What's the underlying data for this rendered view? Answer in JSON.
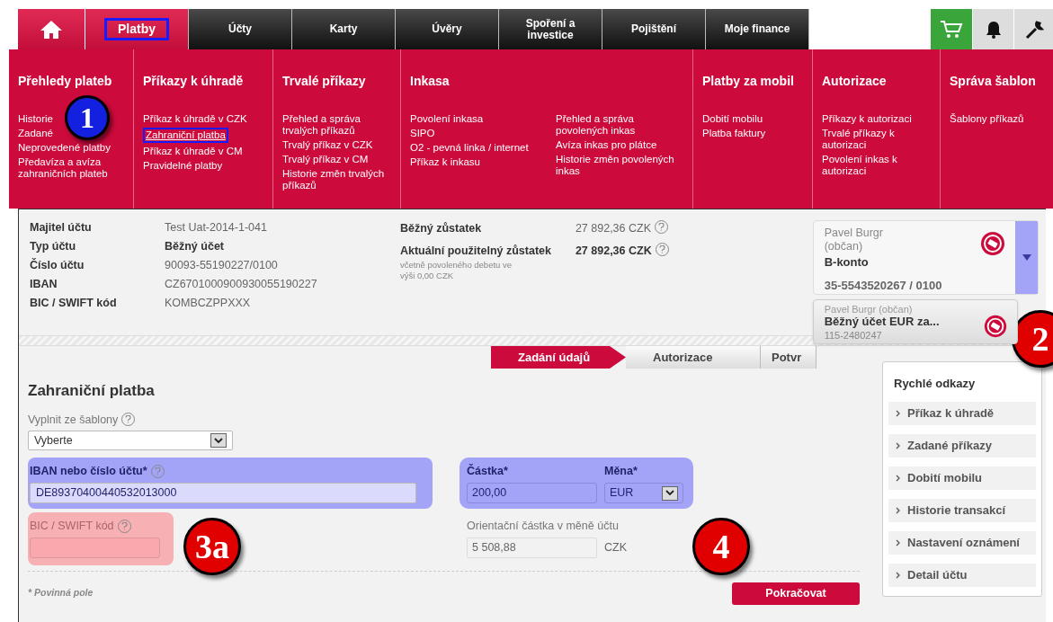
{
  "nav_tabs": [
    {
      "kind": "home"
    },
    {
      "kind": "tab",
      "label": "Platby",
      "selected": true,
      "annotated": true
    },
    {
      "kind": "tab",
      "label": "Účty",
      "selected": false,
      "annotated": false
    },
    {
      "kind": "tab",
      "label": "Karty",
      "selected": false,
      "annotated": false
    },
    {
      "kind": "tab",
      "label": "Úvěry",
      "selected": false,
      "annotated": false
    },
    {
      "kind": "tab",
      "label": "Spoření a investice",
      "selected": false,
      "annotated": false
    },
    {
      "kind": "tab",
      "label": "Pojištění",
      "selected": false,
      "annotated": false
    },
    {
      "kind": "tab",
      "label": "Moje finance",
      "selected": false,
      "annotated": false
    }
  ],
  "menu": {
    "columns": [
      {
        "title": "Přehledy plateb",
        "groups": [
          [
            {
              "label": "Historie",
              "annotated": false
            },
            {
              "label": "Zadané",
              "annotated": false
            },
            {
              "label": "Neprovedené platby",
              "annotated": false
            },
            {
              "label": "Předavíza a avíza zahraničních plateb",
              "annotated": false
            }
          ]
        ]
      },
      {
        "title": "Příkazy k úhradě",
        "groups": [
          [
            {
              "label": "Příkaz k úhradě v CZK",
              "annotated": false
            },
            {
              "label": "Zahraniční platba",
              "annotated": true
            },
            {
              "label": "Příkaz k úhradě v CM",
              "annotated": false
            },
            {
              "label": "Pravidelné platby",
              "annotated": false
            }
          ]
        ]
      },
      {
        "title": "Trvalé příkazy",
        "groups": [
          [
            {
              "label": "Přehled a správa trvalých příkazů",
              "annotated": false
            },
            {
              "label": "Trvalý příkaz v CZK",
              "annotated": false
            },
            {
              "label": "Trvalý příkaz v CM",
              "annotated": false
            },
            {
              "label": "Historie změn trvalých příkazů",
              "annotated": false
            }
          ]
        ]
      },
      {
        "title": "Inkasa",
        "groups": [
          [
            {
              "label": "Povolení inkasa",
              "annotated": false
            },
            {
              "label": "SIPO",
              "annotated": false
            },
            {
              "label": "O2 - pevná linka / internet",
              "annotated": false
            },
            {
              "label": "Příkaz k inkasu",
              "annotated": false
            }
          ],
          [
            {
              "label": "Přehled a správa povolených inkas",
              "annotated": false
            },
            {
              "label": "Avíza inkas pro plátce",
              "annotated": false
            },
            {
              "label": "Historie změn povolených inkas",
              "annotated": false
            }
          ]
        ]
      },
      {
        "title": "Platby za mobil",
        "groups": [
          [
            {
              "label": "Dobití mobilu",
              "annotated": false
            },
            {
              "label": "Platba faktury",
              "annotated": false
            }
          ]
        ]
      },
      {
        "title": "Autorizace",
        "groups": [
          [
            {
              "label": "Příkazy k autorizaci",
              "annotated": false
            },
            {
              "label": "Trvalé příkazy k autorizaci",
              "annotated": false
            },
            {
              "label": "Povolení inkas k autorizaci",
              "annotated": false
            }
          ]
        ]
      },
      {
        "title": "Správa šablon",
        "groups": [
          [
            {
              "label": "Šablony příkazů",
              "annotated": false
            }
          ]
        ]
      }
    ]
  },
  "account_info": [
    {
      "label": "Majitel účtu",
      "value": "Test Uat-2014-1-041",
      "emphasis": false
    },
    {
      "label": "Typ účtu",
      "value": "Běžný účet",
      "emphasis": true
    },
    {
      "label": "Číslo účtu",
      "value": "90093-55190227/0100",
      "emphasis": false
    },
    {
      "label": "IBAN",
      "value": "CZ6701000900930055190227",
      "emphasis": false
    },
    {
      "label": "BIC / SWIFT kód",
      "value": "KOMBCZPPXXX",
      "emphasis": false
    }
  ],
  "balances": [
    {
      "label": "Běžný zůstatek",
      "value": "27 892,36 CZK",
      "emphasis": false
    },
    {
      "label": "Aktuální použitelný zůstatek",
      "note": "včetně povoleného debetu ve výši 0,00 CZK",
      "value": "27 892,36 CZK",
      "emphasis": true
    }
  ],
  "accounts": [
    {
      "owner": "Pavel Burgr (občan)",
      "name": "B-konto",
      "number": "35-5543520267 / 0100",
      "selected": true
    },
    {
      "owner": "Pavel Burgr (občan)",
      "name": "Běžný účet EUR za...",
      "number": "115-2480247",
      "selected": false
    }
  ],
  "steps": [
    {
      "label": "Zadání údajů",
      "selected": true
    },
    {
      "label": "Autorizace",
      "selected": false
    },
    {
      "label": "Potvr",
      "selected": false
    }
  ],
  "form": {
    "title": "Zahraniční platba",
    "template": {
      "label": "Vyplnit ze šablony",
      "value": "Vyberte"
    },
    "iban": {
      "label": "IBAN nebo číslo účtu*",
      "value": "DE89370400440532013000",
      "color": "#a3a3f7"
    },
    "bic": {
      "label": "BIC / SWIFT kód",
      "color": "#f7b0b4"
    },
    "amount": {
      "label": "Částka*",
      "value": "200,00",
      "color": "#a3a3f7"
    },
    "currency": {
      "label": "Měna*",
      "value": "EUR"
    },
    "estimate": {
      "label": "Orientační částka v měně účtu",
      "value": "5 508,88",
      "unit": "CZK"
    },
    "required_note": "* Povinná pole",
    "submit": "Pokračovat"
  },
  "quick_links": {
    "title": "Rychlé odkazy",
    "items": [
      "Příkaz k úhradě",
      "Zadané příkazy",
      "Dobití mobilu",
      "Historie transakcí",
      "Nastavení oznámení",
      "Detail účtu"
    ]
  },
  "callouts": [
    {
      "label": "1",
      "color": "#1420e0"
    },
    {
      "label": "2",
      "color": "#e00000"
    },
    {
      "label": "3a",
      "color": "#e00000"
    },
    {
      "label": "4",
      "color": "#e00000"
    }
  ]
}
